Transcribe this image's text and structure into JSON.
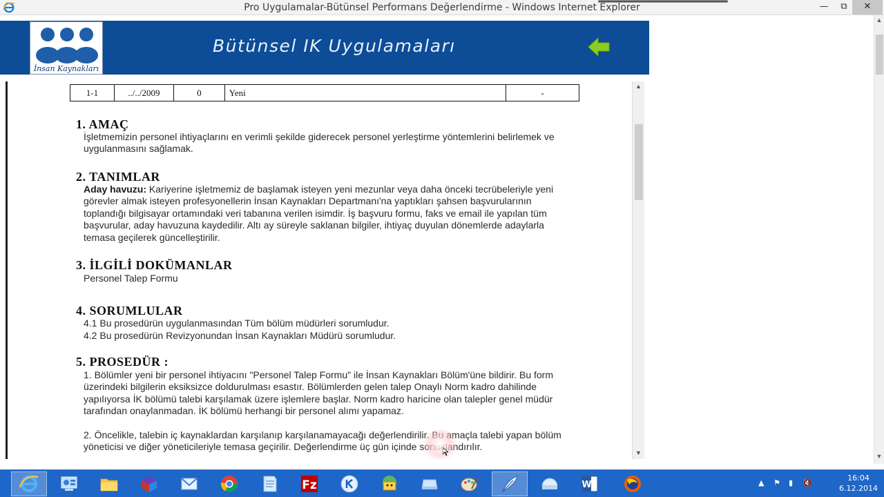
{
  "window": {
    "title": "Pro Uygulamalar-Bütünsel Performans Değerlendirme - Windows Internet Explorer",
    "controls": {
      "minimize": "—",
      "maximize": "⧉",
      "close": "✕"
    }
  },
  "banner": {
    "logo_text": "İnsan Kaynakları",
    "title": "Bütünsel IK Uygulamaları",
    "back_icon": "green-arrow-left-icon",
    "colors": {
      "banner_bg": "#0d4c96",
      "arrow": "#8ccc1e"
    }
  },
  "revision_table": {
    "row": [
      "1-1",
      "../../2009",
      "0",
      "Yeni",
      "-"
    ]
  },
  "sections": [
    {
      "heading": "1. AMAÇ",
      "text": "İşletmemizin personel ihtiyaçlarını en verimli şekilde giderecek personel yerleştirme yöntemlerini belirlemek ve uygulanmasını sağlamak."
    },
    {
      "heading": "2. TANIMLAR",
      "term": "Aday havuzu:",
      "text": " Kariyerine işletmemiz de başlamak isteyen yeni mezunlar veya daha önceki tecrübeleriyle yeni görevler almak isteyen profesyonellerin İnsan Kaynakları Departmanı'na yaptıkları şahsen başvurularının toplandığı bilgisayar ortamındaki veri tabanına verilen isimdir. İş başvuru formu, faks ve email ile yapılan tüm başvurular, aday havuzuna kaydedilir. Altı ay süreyle saklanan bilgiler, ihtiyaç duyulan dönemlerde adaylarla temasa geçilerek güncelleştirilir."
    },
    {
      "heading": "3. İLGİLİ DOKÜMANLAR",
      "text": "Personel Talep Formu"
    },
    {
      "heading": "4. SORUMLULAR",
      "line1": "4.1 Bu prosedürün uygulanmasından Tüm bölüm müdürleri sorumludur.",
      "line2": "4.2 Bu prosedürün Revizyonundan İnsan Kaynakları Müdürü sorumludur."
    },
    {
      "heading": "5. PROSEDÜR :",
      "item1": "1. Bölümler yeni bir personel ihtiyacını \"Personel Talep Formu\" ile İnsan Kaynakları Bölüm'üne bildirir. Bu form üzerindeki bilgilerin eksiksizce doldurulması esastır. Bölümlerden gelen talep Onaylı Norm kadro dahilinde yapılıyorsa İK bölümü talebi karşılamak üzere işlemlere başlar. Norm kadro haricine olan talepler genel müdür tarafından onaylanmadan. İK bölümü herhangi bir personel alımı yapamaz.",
      "item2": "2. Öncelikle, talebin iç kaynaklardan karşılanıp karşılanamayacağı değerlendirilir. Bu amaçla talebi yapan bölüm yöneticisi ve diğer yöneticileriyle temasa geçirilir. Değerlendirme üç gün içinde sonuçlandırılır."
    }
  ],
  "taskbar": {
    "apps": [
      "internet-explorer-icon",
      "control-panel-icon",
      "file-explorer-icon",
      "winrar-icon",
      "mail-icon",
      "chrome-icon",
      "notepad-icon",
      "filezilla-icon",
      "vpn-icon",
      "user-icon",
      "folder-drive-icon",
      "paint-icon",
      "feather-icon",
      "help-icon",
      "word-icon",
      "firefox-icon"
    ],
    "tray": {
      "arrow": "▲",
      "flag": "⚑",
      "battery": "▮",
      "volume": "🔇"
    },
    "time": "16:04",
    "date": "6.12.2014"
  }
}
